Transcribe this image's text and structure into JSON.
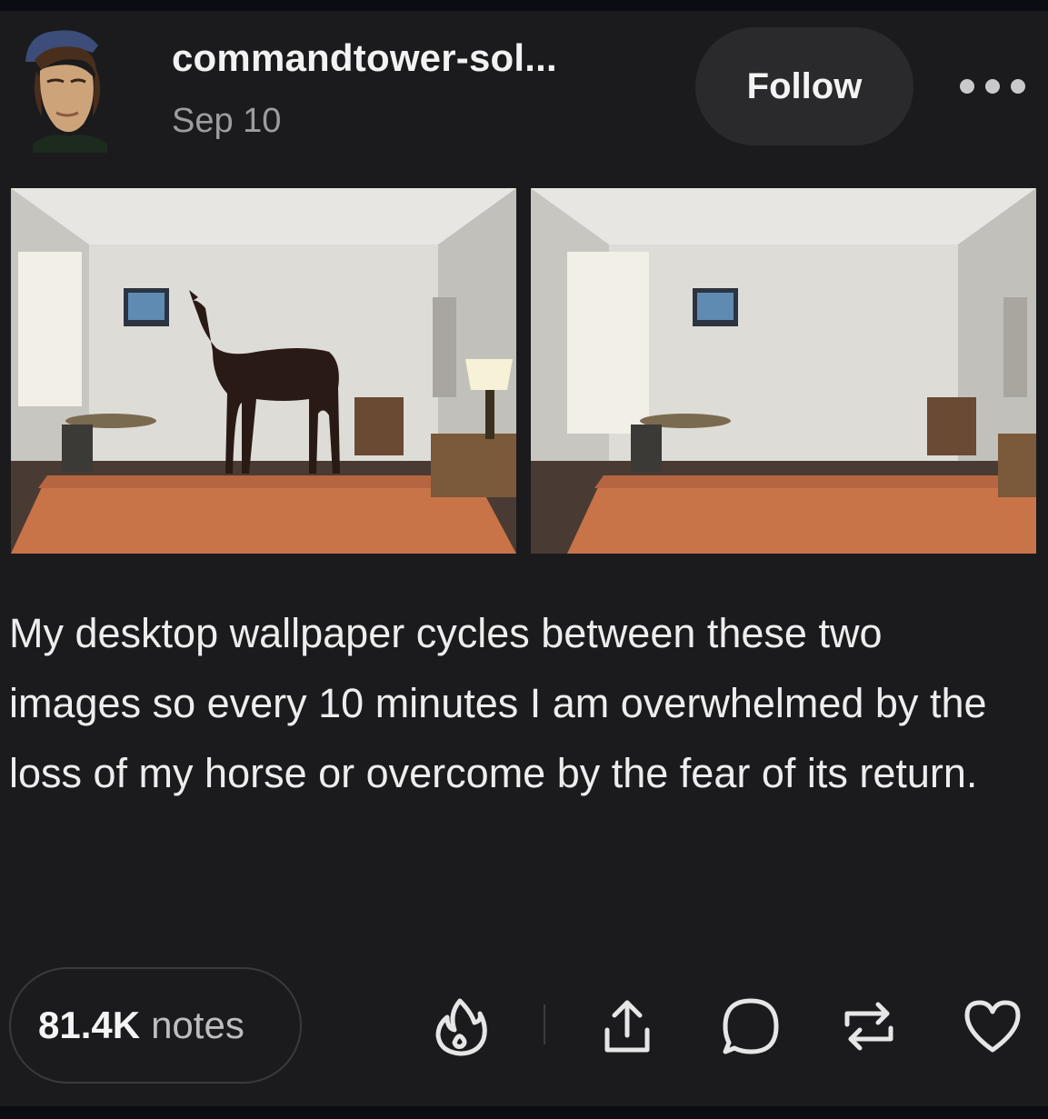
{
  "post": {
    "username": "commandtower-sol...",
    "date": "Sep 10",
    "follow_label": "Follow",
    "caption": "My desktop wallpaper cycles between these two images so every 10 minutes I am overwhelmed by the loss of my horse or overcome by the fear of its return.",
    "notes_count": "81.4K",
    "notes_label": "notes"
  },
  "images": [
    {
      "name": "hotel-room-with-horse"
    },
    {
      "name": "hotel-room-empty"
    }
  ],
  "icons": {
    "more": "ellipsis-icon",
    "blaze": "flame-icon",
    "share": "share-icon",
    "reply": "comment-icon",
    "reblog": "reblog-icon",
    "like": "heart-icon"
  },
  "colors": {
    "background": "#1b1b1d",
    "button": "#2a2a2c",
    "secondary_text": "#9d9d9f"
  }
}
